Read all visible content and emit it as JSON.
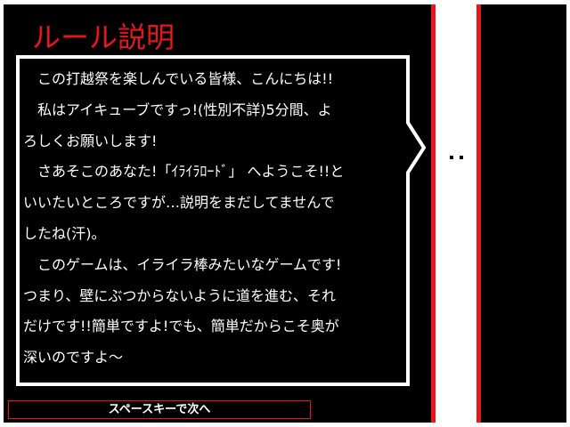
{
  "title": "ルール説明",
  "dialog": {
    "lines": [
      "　この打越祭を楽しんでいる皆様、こんにちは!!",
      "　私はアイキューブですっ!(性別不詳)5分間、よ",
      "ろしくお願いします!",
      "　さあそこのあなた!「ｲﾗｲﾗﾛｰﾄﾞ」 へようこそ!!と",
      "いいたいところですが…説明をまだしてませんで",
      "したね(汗)。",
      "　このゲームは、イライラ棒みたいなゲームです!",
      "つまり、壁にぶつからないように道を進む、それ",
      "だけです!!簡単ですよ!でも、簡単だからこそ奥が",
      "深いのですよ～"
    ]
  },
  "prompt": {
    "label": "スペースキーで次へ"
  },
  "colors": {
    "background": "#000000",
    "accent_red": "#e8161c",
    "text": "#ffffff"
  },
  "icons": {
    "character": "cube-character-icon"
  }
}
